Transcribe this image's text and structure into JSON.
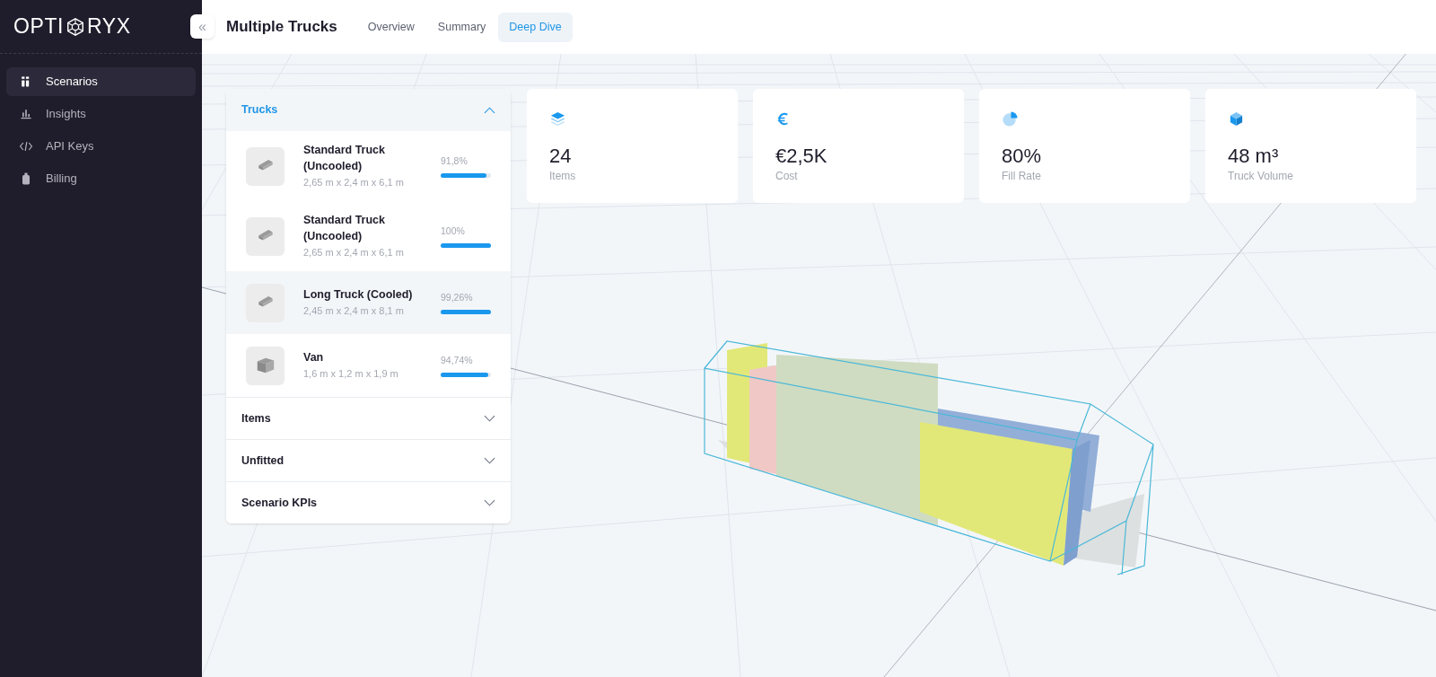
{
  "logo": {
    "text": "OPTI",
    "text_end": "RYX"
  },
  "sidebar": {
    "items": [
      {
        "label": "Scenarios",
        "selected": true
      },
      {
        "label": "Insights",
        "selected": false
      },
      {
        "label": "API Keys",
        "selected": false
      },
      {
        "label": "Billing",
        "selected": false
      }
    ]
  },
  "header": {
    "collapse_button": "«",
    "title": "Multiple Trucks",
    "tabs": [
      {
        "label": "Overview",
        "selected": false
      },
      {
        "label": "Summary",
        "selected": false
      },
      {
        "label": "Deep Dive",
        "selected": true
      }
    ]
  },
  "panel": {
    "sections": [
      {
        "title": "Trucks",
        "expanded": true,
        "items": [
          {
            "kind": "truck",
            "name": "Standard Truck (Uncooled)",
            "dimensions": "2,65 m x 2,4 m x 6,1 m",
            "fill": "91,8%",
            "level": 0.918,
            "selected": false
          },
          {
            "kind": "truck",
            "name": "Standard Truck (Uncooled)",
            "dimensions": "2,65 m x 2,4 m x 6,1 m",
            "fill": "100%",
            "level": 1.0,
            "selected": false
          },
          {
            "kind": "truck",
            "name": "Long Truck (Cooled)",
            "dimensions": "2,45 m x 2,4 m x 8,1 m",
            "fill": "99,26%",
            "level": 0.9926,
            "selected": true
          },
          {
            "kind": "van",
            "name": "Van",
            "dimensions": "1,6 m x 1,2 m x 1,9 m",
            "fill": "94,74%",
            "level": 0.9474,
            "selected": false
          }
        ]
      },
      {
        "title": "Items",
        "expanded": false
      },
      {
        "title": "Unfitted",
        "expanded": false
      },
      {
        "title": "Scenario KPIs",
        "expanded": false
      }
    ]
  },
  "stats": [
    {
      "value": "24",
      "label": "Items"
    },
    {
      "value": "€2,5K",
      "label": "Cost"
    },
    {
      "value": "80%",
      "label": "Fill Rate"
    },
    {
      "value": "48 m³",
      "label": "Truck Volume"
    }
  ]
}
